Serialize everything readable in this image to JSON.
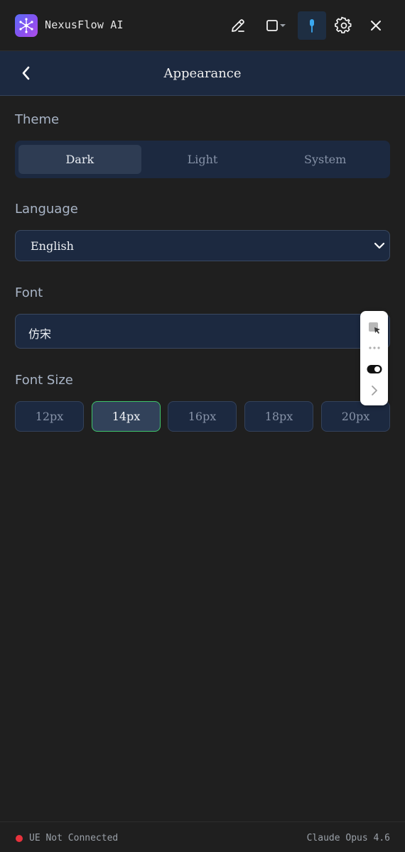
{
  "app": {
    "title": "NexusFlow AI",
    "accent": "#5b6cf6"
  },
  "toolbar": {
    "icons": [
      "edit-icon",
      "window-icon",
      "chevron-down-icon",
      "pin-icon",
      "gear-icon",
      "close-icon"
    ]
  },
  "header": {
    "title": "Appearance",
    "back_icon": "chevron-left-icon"
  },
  "theme": {
    "label": "Theme",
    "options": [
      "Dark",
      "Light",
      "System"
    ],
    "selected": "Dark"
  },
  "language": {
    "label": "Language",
    "value": "English"
  },
  "font": {
    "label": "Font",
    "value": "仿宋"
  },
  "font_size": {
    "label": "Font Size",
    "options": [
      "12px",
      "14px",
      "16px",
      "18px",
      "20px"
    ],
    "selected": "14px",
    "selected_border_color": "#3fc46a"
  },
  "footer": {
    "status": "UE Not Connected",
    "status_color": "#e8323c",
    "model": "Claude Opus 4.6"
  }
}
